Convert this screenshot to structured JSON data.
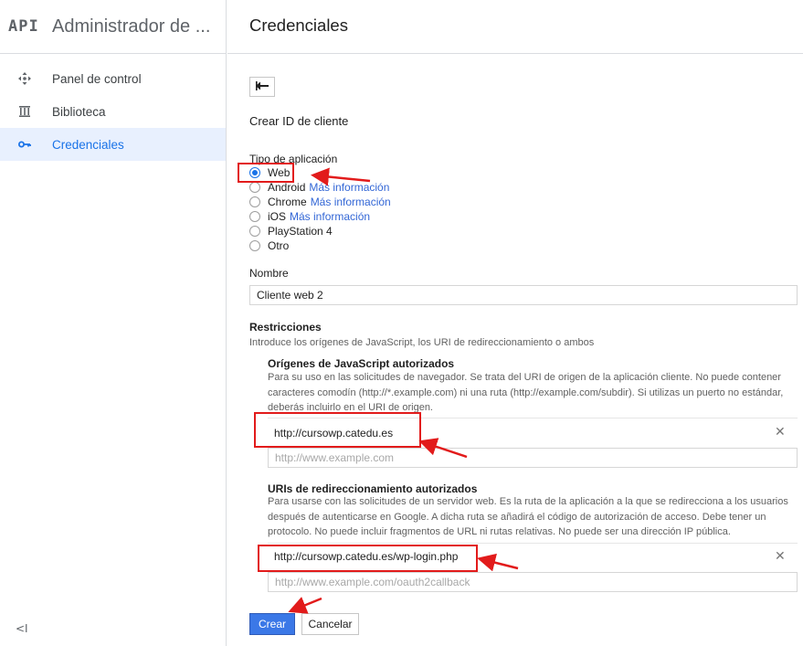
{
  "sidebar": {
    "logo": "API",
    "title": "Administrador de ...",
    "items": [
      {
        "label": "Panel de control",
        "icon": "dashboard-icon"
      },
      {
        "label": "Biblioteca",
        "icon": "library-icon"
      },
      {
        "label": "Credenciales",
        "icon": "key-icon",
        "active": true
      }
    ],
    "collapse_label": "<I"
  },
  "header": {
    "title": "Credenciales"
  },
  "form": {
    "back_icon": "back-arrow-icon",
    "heading": "Crear ID de cliente",
    "app_type": {
      "label": "Tipo de aplicación",
      "options": [
        {
          "label": "Web",
          "checked": true,
          "link": ""
        },
        {
          "label": "Android",
          "checked": false,
          "link": "Más información"
        },
        {
          "label": "Chrome",
          "checked": false,
          "link": "Más información"
        },
        {
          "label": "iOS",
          "checked": false,
          "link": "Más información"
        },
        {
          "label": "PlayStation 4",
          "checked": false,
          "link": ""
        },
        {
          "label": "Otro",
          "checked": false,
          "link": ""
        }
      ]
    },
    "name": {
      "label": "Nombre",
      "value": "Cliente web 2"
    },
    "restrictions": {
      "label": "Restricciones",
      "description": "Introduce los orígenes de JavaScript, los URI de redireccionamiento o ambos",
      "js_origins": {
        "label": "Orígenes de JavaScript autorizados",
        "description_lines": [
          "Para su uso en las solicitudes de navegador. Se trata del URI de origen de la aplicación cliente. No puede contener",
          "caracteres comodín (http://*.example.com) ni una ruta (http://example.com/subdir). Si utilizas un puerto no estándar,",
          "deberás incluirlo en el URI de origen."
        ],
        "entry": "http://cursowp.catedu.es",
        "placeholder": "http://www.example.com"
      },
      "redirect_uris": {
        "label": "URIs de redireccionamiento autorizados",
        "description_lines": [
          "Para usarse con las solicitudes de un servidor web. Es la ruta de la aplicación a la que se redirecciona a los usuarios",
          "después de autenticarse en Google. A dicha ruta se añadirá el código de autorización de acceso. Debe tener un",
          "protocolo. No puede incluir fragmentos de URL ni rutas relativas. No puede ser una dirección IP pública."
        ],
        "entry": "http://cursowp.catedu.es/wp-login.php",
        "placeholder": "http://www.example.com/oauth2callback"
      }
    },
    "remove_icon": "close-icon",
    "create_label": "Crear",
    "cancel_label": "Cancelar"
  },
  "colors": {
    "accent": "#1a73e8",
    "primary_button": "#3b78e7",
    "annotation": "#e21b1b",
    "active_nav_bg": "#e8f0fe"
  }
}
